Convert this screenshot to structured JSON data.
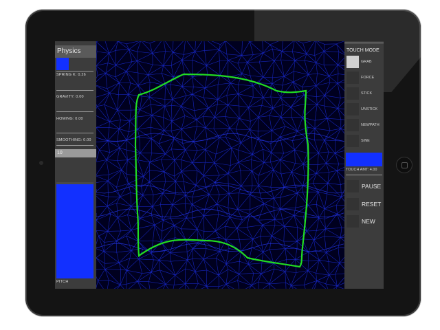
{
  "left_panel": {
    "title": "Physics",
    "params": [
      {
        "label": "SPRING K: 0.26"
      },
      {
        "label": "GRAVITY: 0.00"
      },
      {
        "label": "HOMING: 0.00"
      },
      {
        "label": "SMOOTHING: 0.00"
      }
    ],
    "pitch_value": "10",
    "pitch_label": "PITCH",
    "pitch_level": 0.98
  },
  "right_panel": {
    "title": "TOUCH MODE",
    "modes": [
      {
        "label": "GRAB",
        "active": true
      },
      {
        "label": "FORCE",
        "active": false
      },
      {
        "label": "STICK",
        "active": false
      },
      {
        "label": "UNSTICK",
        "active": false
      },
      {
        "label": "NEWPATH",
        "active": false
      },
      {
        "label": "SINE",
        "active": false
      }
    ],
    "touch_amount_label": "TOUCH AMT: 4.00",
    "actions": [
      {
        "label": "PAUSE"
      },
      {
        "label": "RESET"
      },
      {
        "label": "NEW"
      }
    ]
  },
  "colors": {
    "accent": "#1230ff",
    "mesh": "#1a2cd8",
    "outline": "#22dd22",
    "panel": "#3c3c3c"
  }
}
